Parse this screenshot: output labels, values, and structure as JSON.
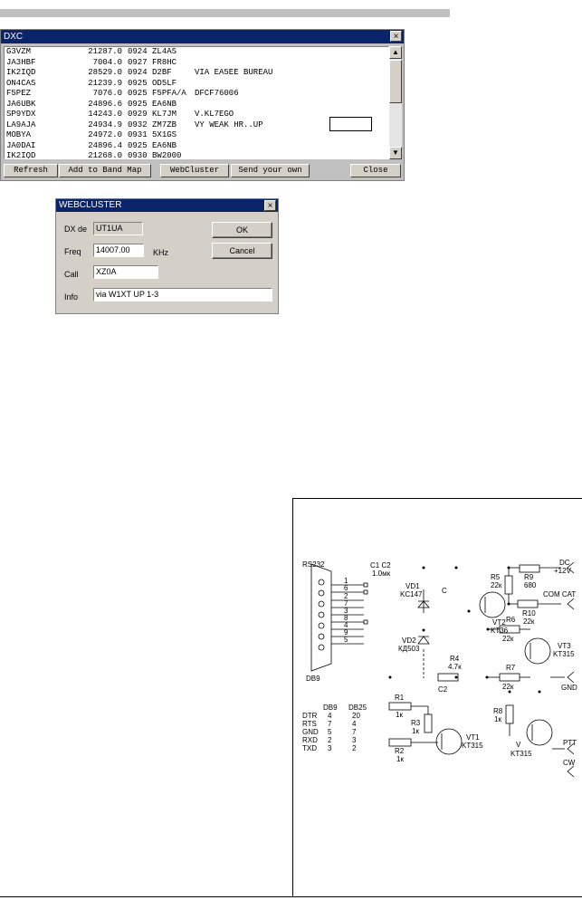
{
  "dxc": {
    "title": "DXC",
    "close_glyph": "×",
    "spots": [
      {
        "call": "G3VZM",
        "freq": "21287.0",
        "time": "0924",
        "dx": "ZL4AS",
        "comment": ""
      },
      {
        "call": "JA3HBF",
        "freq": "7004.0",
        "time": "0927",
        "dx": "FR8HC",
        "comment": ""
      },
      {
        "call": "IK2IQD",
        "freq": "28529.0",
        "time": "0924",
        "dx": "D2BF",
        "comment": "VIA EA5EE BUREAU"
      },
      {
        "call": "ON4CAS",
        "freq": "21239.9",
        "time": "0925",
        "dx": "OD5LF",
        "comment": ""
      },
      {
        "call": "F5PEZ",
        "freq": "7076.0",
        "time": "0925",
        "dx": "F5PFA/A",
        "comment": "DFCF76006"
      },
      {
        "call": "JA6UBK",
        "freq": "24896.6",
        "time": "0925",
        "dx": "EA6NB",
        "comment": ""
      },
      {
        "call": "SP9YDX",
        "freq": "14243.0",
        "time": "0929",
        "dx": "KL7JM",
        "comment": "V.KL7EGO"
      },
      {
        "call": "LA9AJA",
        "freq": "24934.9",
        "time": "0932",
        "dx": "ZM7ZB",
        "comment": "VY WEAK HR..UP"
      },
      {
        "call": "MOBYA",
        "freq": "24972.0",
        "time": "0931",
        "dx": "5X1GS",
        "comment": ""
      },
      {
        "call": "JA0DAI",
        "freq": "24896.4",
        "time": "0925",
        "dx": "EA6NB",
        "comment": ""
      },
      {
        "call": "IK2IQD",
        "freq": "21268.0",
        "time": "0930",
        "dx": "BW2000",
        "comment": ""
      }
    ],
    "buttons": {
      "refresh": "Refresh",
      "add_band_map": "Add to Band Map",
      "webcluster": "WebCluster",
      "send_own": "Send your own",
      "close": "Close"
    },
    "scroll_up": "▲",
    "scroll_down": "▼"
  },
  "webcluster": {
    "title": "WEBCLUSTER",
    "close_glyph": "×",
    "dx_de_label": "DX de",
    "dx_de_value": "UT1UA",
    "freq_label": "Freq",
    "freq_value": "14007.00",
    "freq_unit": "KHz",
    "call_label": "Call",
    "call_value": "XZ0A",
    "info_label": "Info",
    "info_value": "via W1XT  UP 1-3",
    "ok": "OK",
    "cancel": "Cancel"
  },
  "schematic": {
    "connector_label": "RS232",
    "connector_name": "DB9",
    "pins": [
      "1",
      "6",
      "2",
      "7",
      "3",
      "8",
      "4",
      "9",
      "5"
    ],
    "caps_label": "C1 C2",
    "caps_value": "1.0мк",
    "c_label": "C",
    "vd1": "VD1",
    "vd1_type": "KC147",
    "vd2": "VD2",
    "vd2_type": "КД503",
    "r4": "R4",
    "r4_val": "4.7к",
    "c2": "C2",
    "r5": "R5",
    "r5_val": "22к",
    "r9": "R9",
    "r9_val": "680",
    "r10": "R10",
    "r10_val": "22к",
    "vt2": "VT2",
    "vt2_type": "KT36",
    "r6": "R6",
    "r6_val": "22к",
    "r7": "R7",
    "r7_val": "22к",
    "vt3": "VT3",
    "vt3_type": "KT315",
    "r1": "R1",
    "r1_val": "1к",
    "r2": "R2",
    "r2_val": "1к",
    "r3": "R3",
    "r3_val": "1к",
    "vt1": "VT1",
    "vt1_type": "KT315",
    "r8": "R8",
    "r8_val": "1к",
    "vt4": "V",
    "vt4_type": "KT315",
    "dc": "DC",
    "dc_val": "+12V",
    "com_cat": "COM CAT",
    "gnd": "GND",
    "ptt": "PTT",
    "cw": "CW",
    "table_header": [
      "DB9",
      "DB25"
    ],
    "table": [
      {
        "sig": "DTR",
        "db9": "4",
        "db25": "20"
      },
      {
        "sig": "RTS",
        "db9": "7",
        "db25": "4"
      },
      {
        "sig": "GND",
        "db9": "5",
        "db25": "7"
      },
      {
        "sig": "RXD",
        "db9": "2",
        "db25": "3"
      },
      {
        "sig": "TXD",
        "db9": "3",
        "db25": "2"
      }
    ]
  }
}
